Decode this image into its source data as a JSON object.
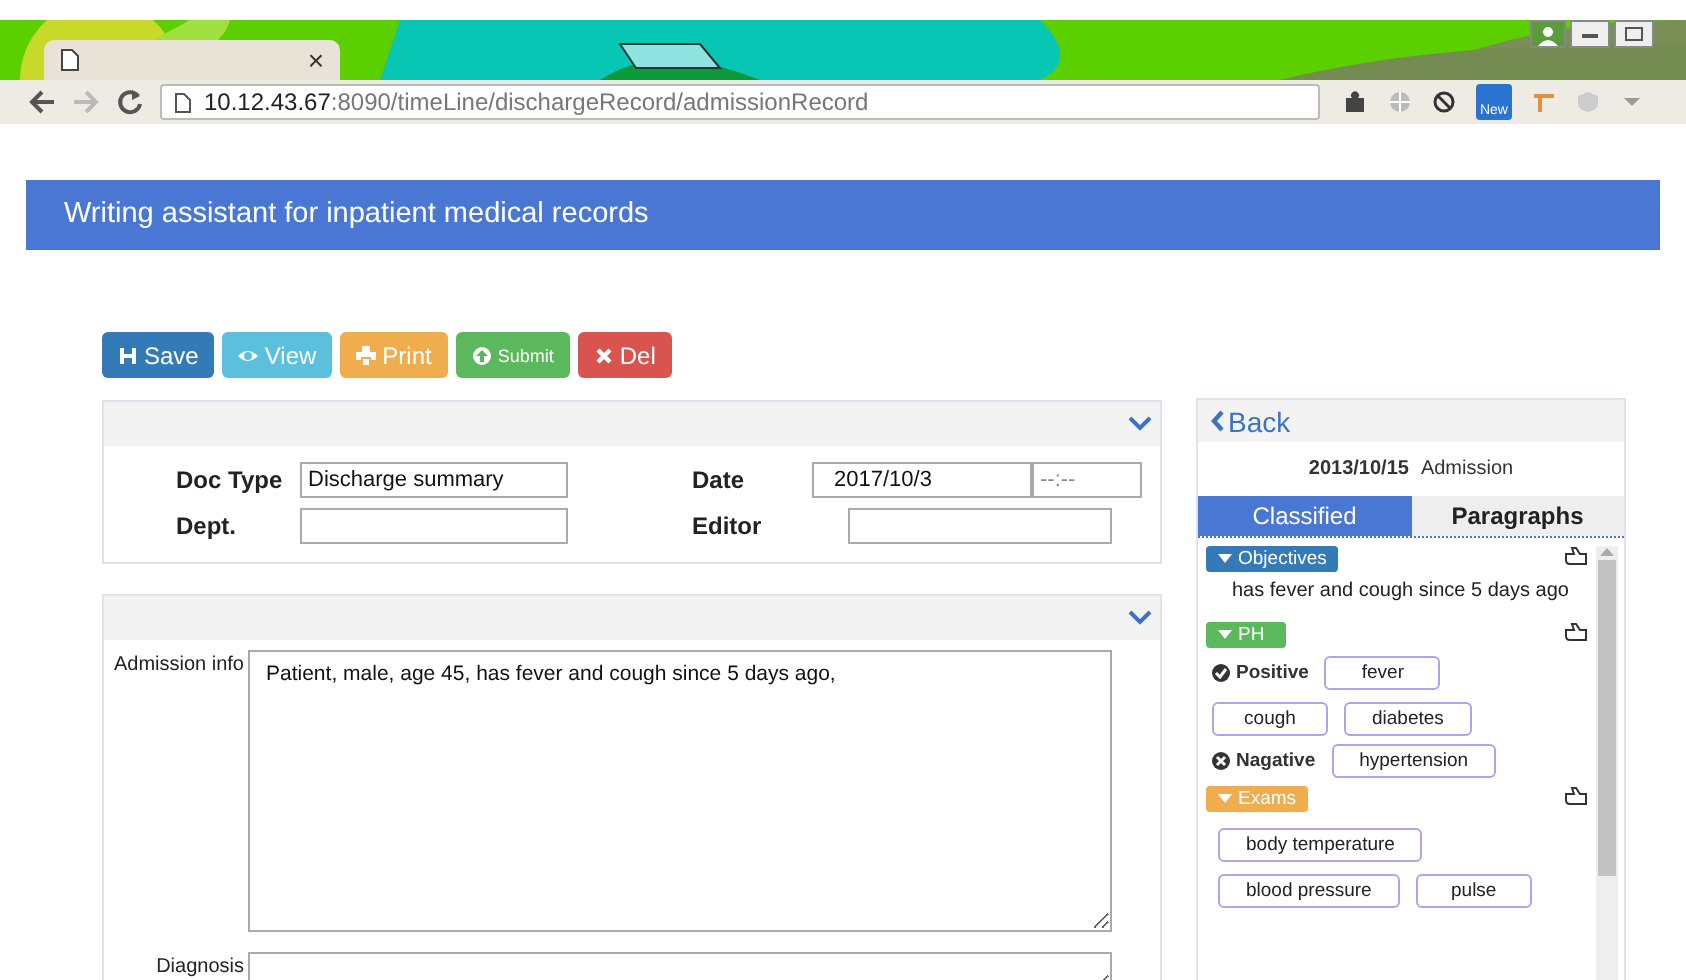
{
  "browser": {
    "tab_close": "×",
    "url_host": "10.12.43.67",
    "url_path": ":8090/timeLine/dischargeRecord/admissionRecord",
    "extension_badge": "New"
  },
  "header": {
    "title": "Writing assistant for inpatient medical records"
  },
  "actions": [
    {
      "label": "Save",
      "kind": "save"
    },
    {
      "label": "View",
      "kind": "view"
    },
    {
      "label": "Print",
      "kind": "print"
    },
    {
      "label": "Submit",
      "kind": "submit"
    },
    {
      "label": "Del",
      "kind": "delete"
    }
  ],
  "fields": [
    {
      "label": "Doc Type",
      "value": "Discharge summary"
    },
    {
      "label": "Date",
      "value": "2017/10/3",
      "placeholder": "--:--"
    },
    {
      "label": "Dept."
    },
    {
      "label": "Editor"
    }
  ],
  "record": {
    "admission_label": "Admission info",
    "admission_value": "Patient, male, age 45, has fever and cough since 5 days ago,",
    "diagnosis_label": "Diagnosis"
  },
  "side": {
    "back": "Back",
    "date": "2013/10/15",
    "type": "Admission",
    "tabs": [
      {
        "label": "Classified",
        "selected": true
      },
      {
        "label": "Paragraphs",
        "selected": false
      }
    ],
    "sections": [
      {
        "title": "Objectives",
        "color": "#337ab7",
        "text": "has fever and cough since 5 days ago"
      },
      {
        "title": "PH",
        "color": "#5cb85c",
        "groups": [
          {
            "kind": "positive",
            "label": "Positive",
            "tags": [
              "fever",
              "cough",
              "diabetes"
            ]
          },
          {
            "kind": "negative",
            "label": "Nagative",
            "tags": [
              "hypertension"
            ]
          }
        ]
      },
      {
        "title": "Exams",
        "color": "#f0ad4e",
        "tags": [
          "body temperature",
          "blood pressure",
          "pulse"
        ]
      }
    ]
  }
}
